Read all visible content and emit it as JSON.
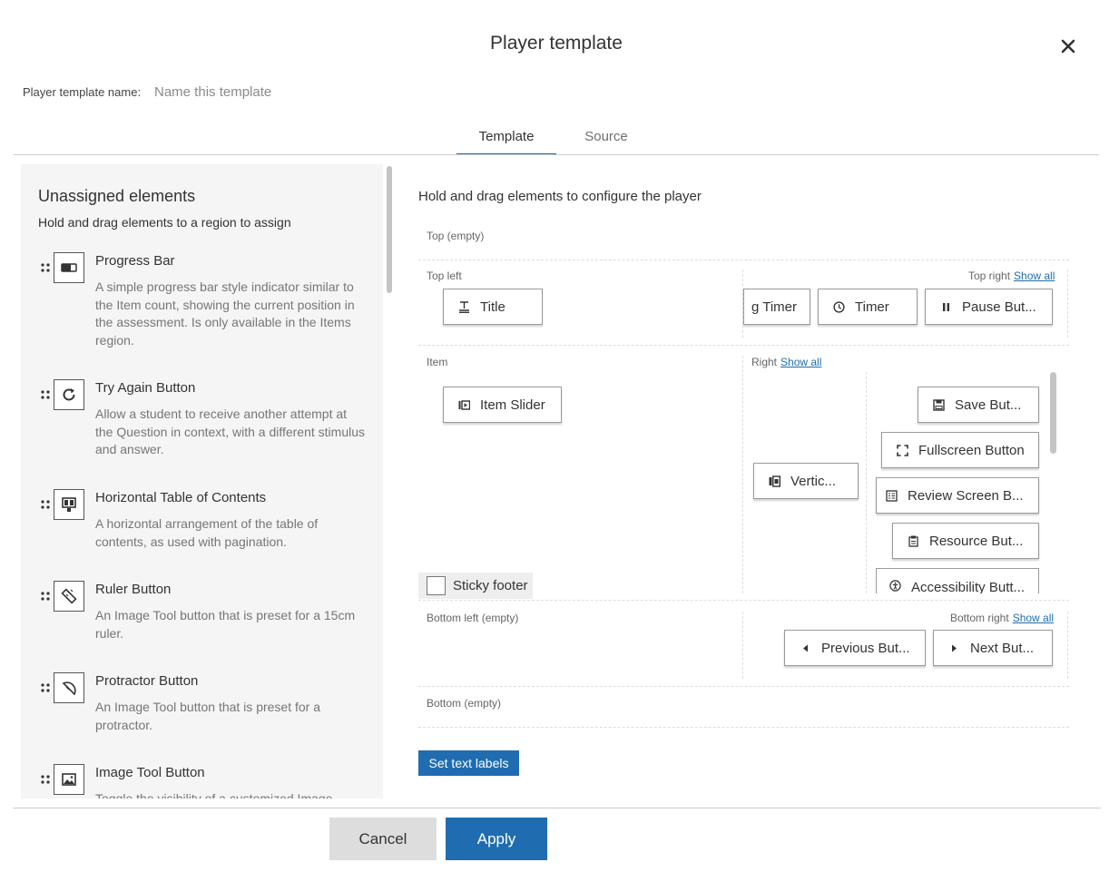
{
  "dialog": {
    "title": "Player template",
    "close_icon": "close-icon",
    "name_label": "Player template name:",
    "name_placeholder": "Name this template",
    "name_value": ""
  },
  "tabs": [
    {
      "label": "Template",
      "active": true
    },
    {
      "label": "Source",
      "active": false
    }
  ],
  "unassigned": {
    "title": "Unassigned elements",
    "subtitle": "Hold and drag elements to a region to assign",
    "items": [
      {
        "name": "Progress Bar",
        "icon": "progress-bar-icon",
        "description": "A simple progress bar style indicator similar to the Item count, showing the current position in the assessment. Is only available in the Items region."
      },
      {
        "name": "Try Again Button",
        "icon": "refresh-icon",
        "description": "Allow a student to receive another attempt at the Question in context, with a different stimulus and answer."
      },
      {
        "name": "Horizontal Table of Contents",
        "icon": "table-of-contents-icon",
        "description": "A horizontal arrangement of the table of contents, as used with pagination."
      },
      {
        "name": "Ruler Button",
        "icon": "ruler-icon",
        "description": "An Image Tool button that is preset for a 15cm ruler."
      },
      {
        "name": "Protractor Button",
        "icon": "protractor-icon",
        "description": "An Image Tool button that is preset for a protractor."
      },
      {
        "name": "Image Tool Button",
        "icon": "image-icon",
        "description": "Toggle the visibility of a customized Image"
      }
    ]
  },
  "layout": {
    "hint": "Hold and drag elements to configure the player",
    "show_all": "Show all",
    "regions": {
      "top": "Top (empty)",
      "top_left": "Top left",
      "top_right": "Top right",
      "item": "Item",
      "right": "Right",
      "bottom_left": "Bottom left (empty)",
      "bottom_right": "Bottom right",
      "bottom": "Bottom (empty)"
    },
    "top_left_elements": [
      {
        "label": "Title",
        "icon": "title-icon"
      }
    ],
    "top_right_elements": [
      {
        "label": "g Timer",
        "icon": "none"
      },
      {
        "label": "Timer",
        "icon": "clock-icon"
      },
      {
        "label": "Pause But...",
        "icon": "pause-icon"
      }
    ],
    "item_elements": [
      {
        "label": "Item Slider",
        "icon": "item-slider-icon"
      }
    ],
    "right_elements": [
      {
        "label": "Vertic...",
        "icon": "vertical-toc-icon"
      },
      {
        "label": "Save But...",
        "icon": "save-icon"
      },
      {
        "label": "Fullscreen Button",
        "icon": "fullscreen-icon"
      },
      {
        "label": "Review Screen B...",
        "icon": "review-screen-icon"
      },
      {
        "label": "Resource But...",
        "icon": "resource-icon"
      },
      {
        "label": "Accessibility Butt...",
        "icon": "accessibility-icon"
      }
    ],
    "bottom_right_elements": [
      {
        "label": "Previous But...",
        "icon": "caret-left-icon"
      },
      {
        "label": "Next But...",
        "icon": "caret-right-icon"
      }
    ],
    "sticky_footer": {
      "label": "Sticky footer",
      "checked": false
    },
    "set_text_labels": "Set text labels"
  },
  "footer": {
    "cancel": "Cancel",
    "apply": "Apply"
  },
  "colors": {
    "accent": "#1f6db0",
    "panel_bg": "#f5f5f5",
    "cancel_bg": "#dddddd"
  }
}
